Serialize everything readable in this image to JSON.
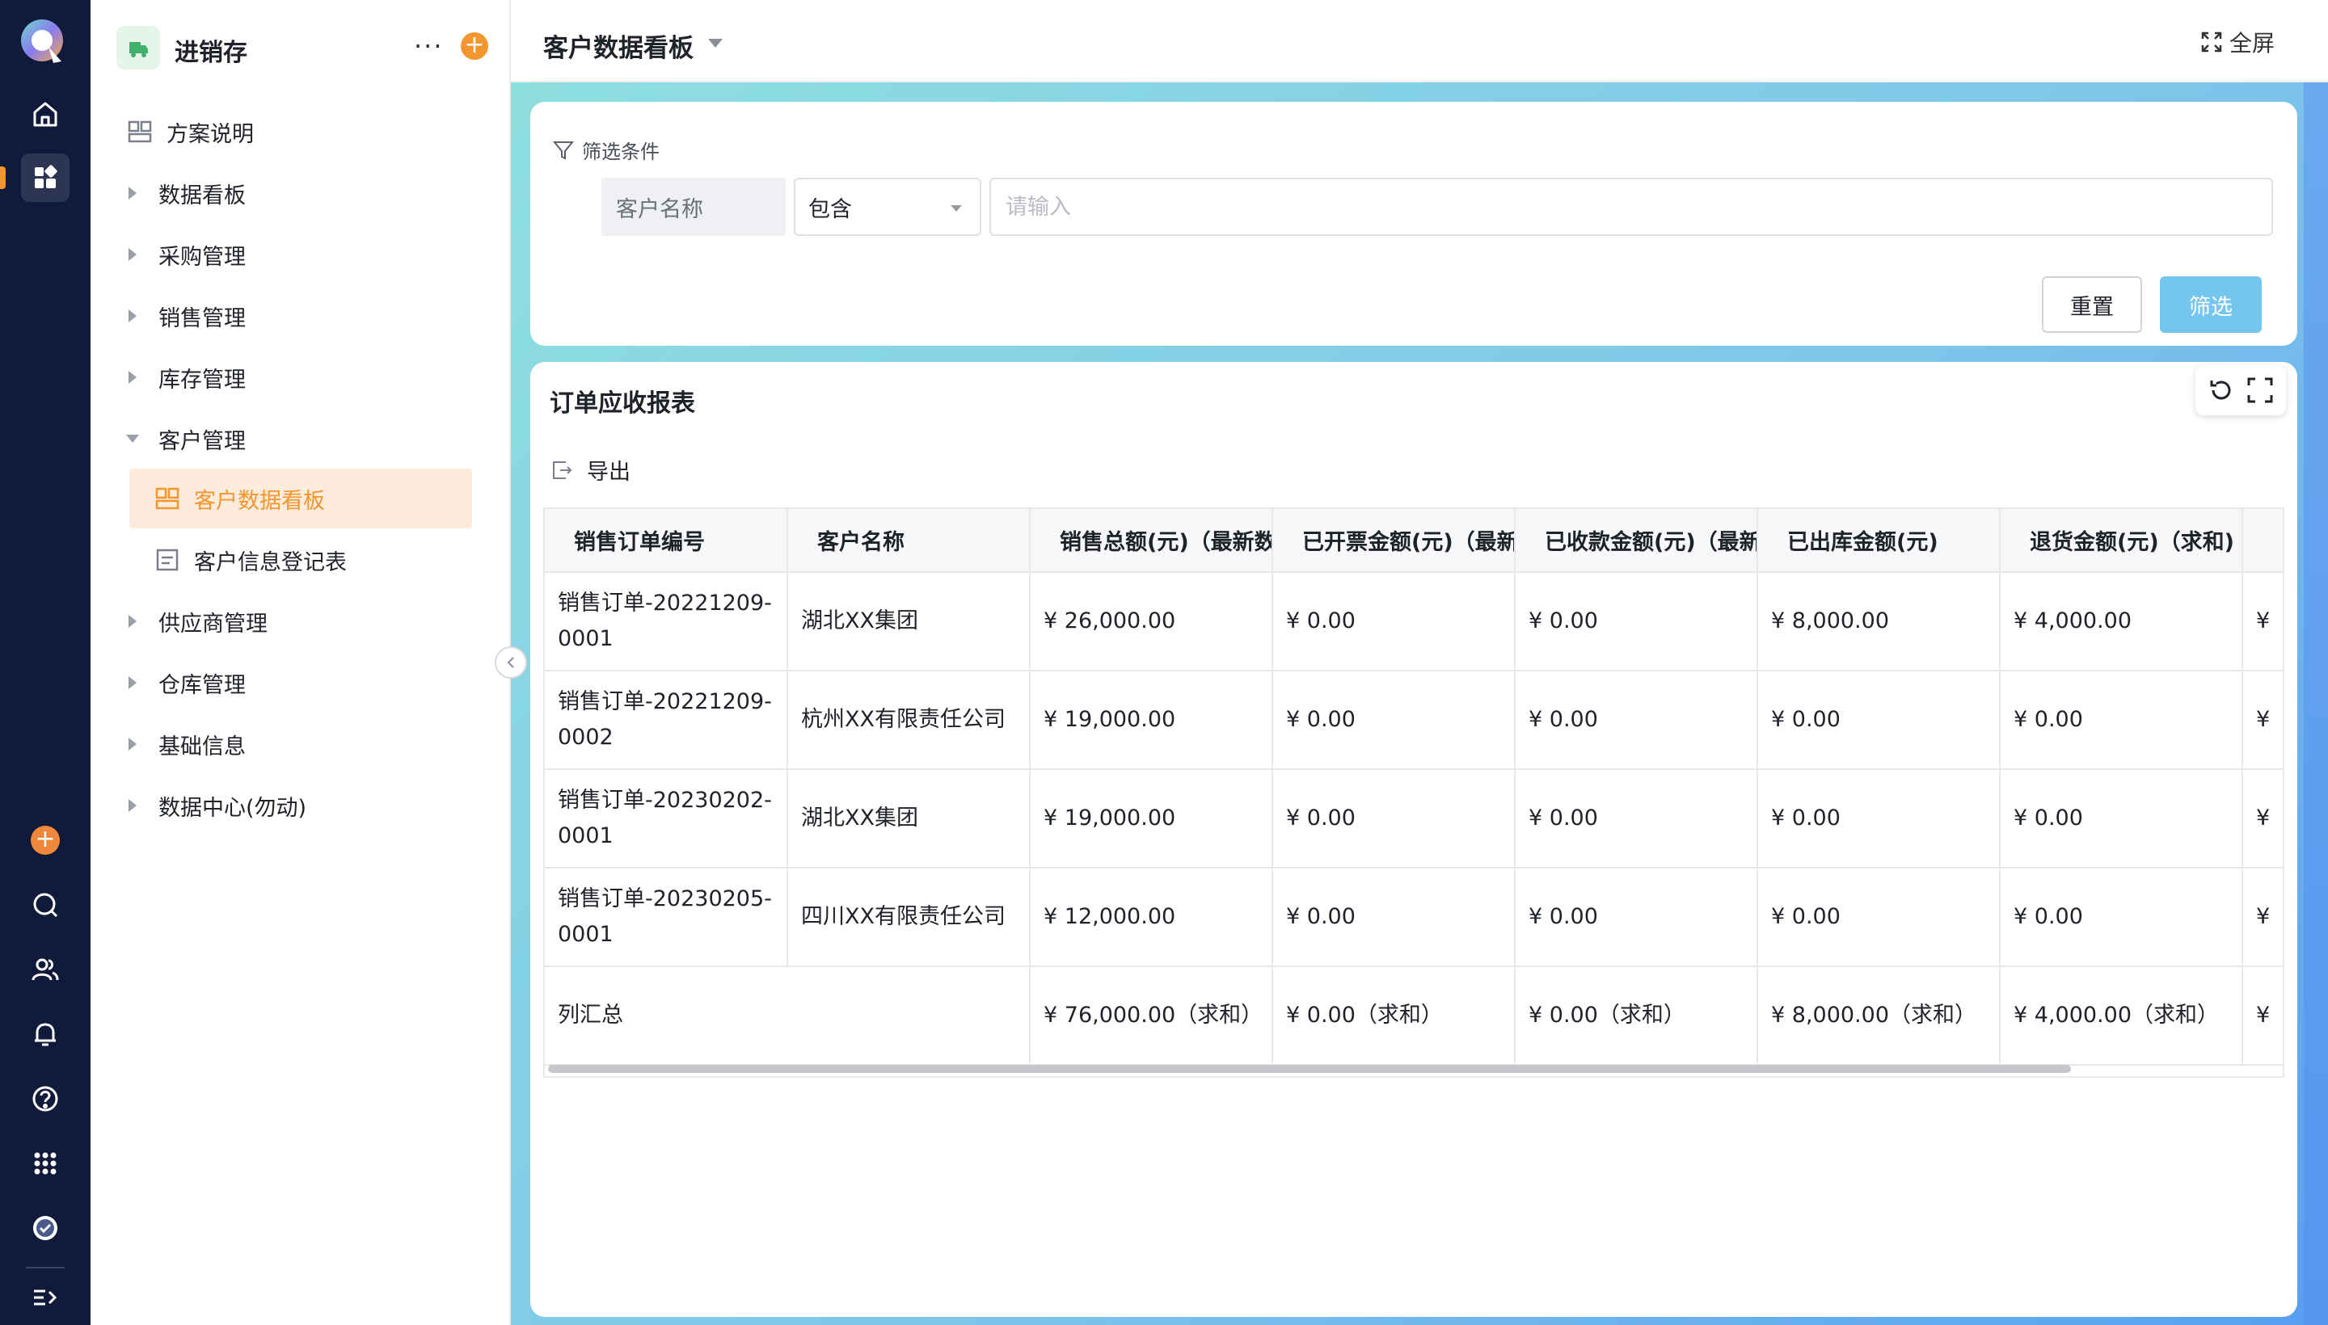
{
  "header": {
    "title": "客户数据看板",
    "fullscreen_label": "全屏"
  },
  "app": {
    "name": "进销存",
    "more_label": "···",
    "add_label": "+"
  },
  "nav": {
    "items": [
      {
        "label": "方案说明"
      },
      {
        "label": "数据看板"
      },
      {
        "label": "采购管理"
      },
      {
        "label": "销售管理"
      },
      {
        "label": "库存管理"
      },
      {
        "label": "客户管理"
      },
      {
        "label": "客户数据看板"
      },
      {
        "label": "客户信息登记表"
      },
      {
        "label": "供应商管理"
      },
      {
        "label": "仓库管理"
      },
      {
        "label": "基础信息"
      },
      {
        "label": "数据中心(勿动)"
      }
    ]
  },
  "filter": {
    "title": "筛选条件",
    "field_label": "客户名称",
    "operator": "包含",
    "placeholder": "请输入",
    "reset_label": "重置",
    "submit_label": "筛选"
  },
  "report": {
    "title": "订单应收报表",
    "export_label": "导出",
    "columns": [
      "销售订单编号",
      "客户名称",
      "销售总额(元)（最新数",
      "已开票金额(元)（最新",
      "已收款金额(元)（最新",
      "已出库金额(元)",
      "退货金额(元)（求和)",
      ""
    ],
    "rows": [
      {
        "order": "销售订单-20221209-0001",
        "customer": "湖北XX集团",
        "sales": "¥ 26,000.00",
        "invoiced": "¥ 0.00",
        "received": "¥ 0.00",
        "shipped": "¥ 8,000.00",
        "returned": "¥ 4,000.00",
        "extra": "¥"
      },
      {
        "order": "销售订单-20221209-0002",
        "customer": "杭州XX有限责任公司",
        "sales": "¥ 19,000.00",
        "invoiced": "¥ 0.00",
        "received": "¥ 0.00",
        "shipped": "¥ 0.00",
        "returned": "¥ 0.00",
        "extra": "¥"
      },
      {
        "order": "销售订单-20230202-0001",
        "customer": "湖北XX集团",
        "sales": "¥ 19,000.00",
        "invoiced": "¥ 0.00",
        "received": "¥ 0.00",
        "shipped": "¥ 0.00",
        "returned": "¥ 0.00",
        "extra": "¥"
      },
      {
        "order": "销售订单-20230205-0001",
        "customer": "四川XX有限责任公司",
        "sales": "¥ 12,000.00",
        "invoiced": "¥ 0.00",
        "received": "¥ 0.00",
        "shipped": "¥ 0.00",
        "returned": "¥ 0.00",
        "extra": "¥"
      }
    ],
    "summary": {
      "label": "列汇总",
      "customer": "",
      "sales": "¥ 76,000.00（求和）",
      "invoiced": "¥ 0.00（求和）",
      "received": "¥ 0.00（求和）",
      "shipped": "¥ 8,000.00（求和）",
      "returned": "¥ 4,000.00（求和）",
      "extra": "¥"
    }
  },
  "rail": {
    "icons": [
      "logo-icon",
      "home-icon",
      "dashboard-icon",
      "plus-icon",
      "search-icon",
      "users-icon",
      "bell-icon",
      "help-icon",
      "apps-icon",
      "verified-icon",
      "expand-menu-icon"
    ]
  },
  "colors": {
    "accent": "#f3962f",
    "rail_bg": "#111a3a",
    "primary_button": "#74c6ee",
    "active_nav_bg": "#fdebdc"
  }
}
